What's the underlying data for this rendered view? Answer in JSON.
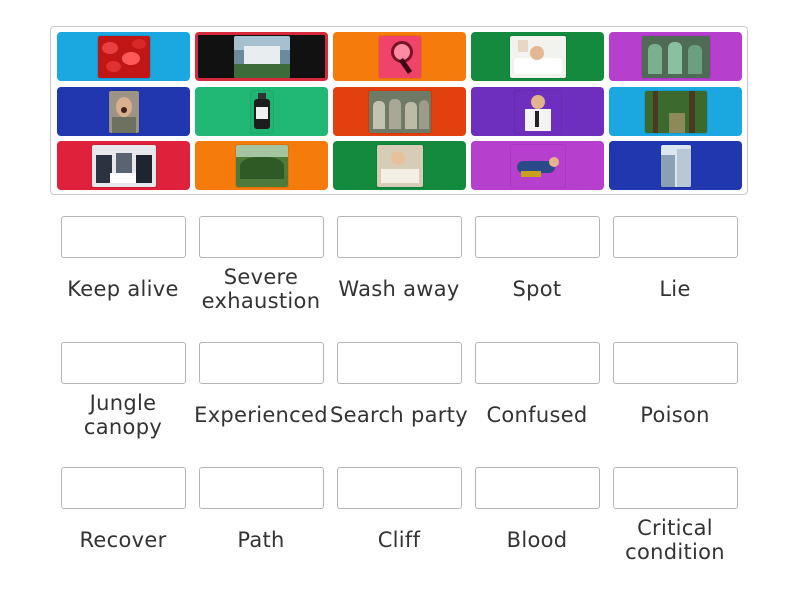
{
  "colors": {
    "cyan": "#1ba7e0",
    "black": "#111111",
    "orange": "#f47b0c",
    "green": "#138a3e",
    "magenta": "#b73fce",
    "blue": "#2037b0",
    "teal": "#21b774",
    "red_orange": "#e2400f",
    "purple": "#6f2fbe",
    "red": "#e0213c",
    "selected_border": "#d6293c"
  },
  "tiles": [
    {
      "name": "blood-cells-image",
      "bg": "cyan",
      "selected": false
    },
    {
      "name": "dam-waterfall-image",
      "bg": "black",
      "selected": true
    },
    {
      "name": "magnifying-glass-image",
      "bg": "orange",
      "selected": false
    },
    {
      "name": "tired-person-bed-image",
      "bg": "green",
      "selected": false
    },
    {
      "name": "surgery-team-image",
      "bg": "magenta",
      "selected": false
    },
    {
      "name": "screaming-man-image",
      "bg": "blue",
      "selected": false
    },
    {
      "name": "poison-bottle-image",
      "bg": "teal",
      "selected": false
    },
    {
      "name": "search-group-image",
      "bg": "red_orange",
      "selected": false
    },
    {
      "name": "confused-man-image",
      "bg": "purple",
      "selected": false
    },
    {
      "name": "forest-path-image",
      "bg": "cyan",
      "selected": false
    },
    {
      "name": "business-meeting-image",
      "bg": "red",
      "selected": false
    },
    {
      "name": "jungle-canopy-image",
      "bg": "orange",
      "selected": false
    },
    {
      "name": "hospital-patient-image",
      "bg": "green",
      "selected": false
    },
    {
      "name": "lying-person-image",
      "bg": "magenta",
      "selected": false
    },
    {
      "name": "cliff-image",
      "bg": "blue",
      "selected": false
    }
  ],
  "answers": [
    {
      "slot_value": "",
      "label": "Keep alive"
    },
    {
      "slot_value": "",
      "label": "Severe exhaustion"
    },
    {
      "slot_value": "",
      "label": "Wash away"
    },
    {
      "slot_value": "",
      "label": "Spot"
    },
    {
      "slot_value": "",
      "label": "Lie"
    },
    {
      "slot_value": "",
      "label": "Jungle canopy"
    },
    {
      "slot_value": "",
      "label": "Experienced"
    },
    {
      "slot_value": "",
      "label": "Search party"
    },
    {
      "slot_value": "",
      "label": "Confused"
    },
    {
      "slot_value": "",
      "label": "Poison"
    },
    {
      "slot_value": "",
      "label": "Recover"
    },
    {
      "slot_value": "",
      "label": "Path"
    },
    {
      "slot_value": "",
      "label": "Cliff"
    },
    {
      "slot_value": "",
      "label": "Blood"
    },
    {
      "slot_value": "",
      "label": "Critical condition"
    }
  ]
}
